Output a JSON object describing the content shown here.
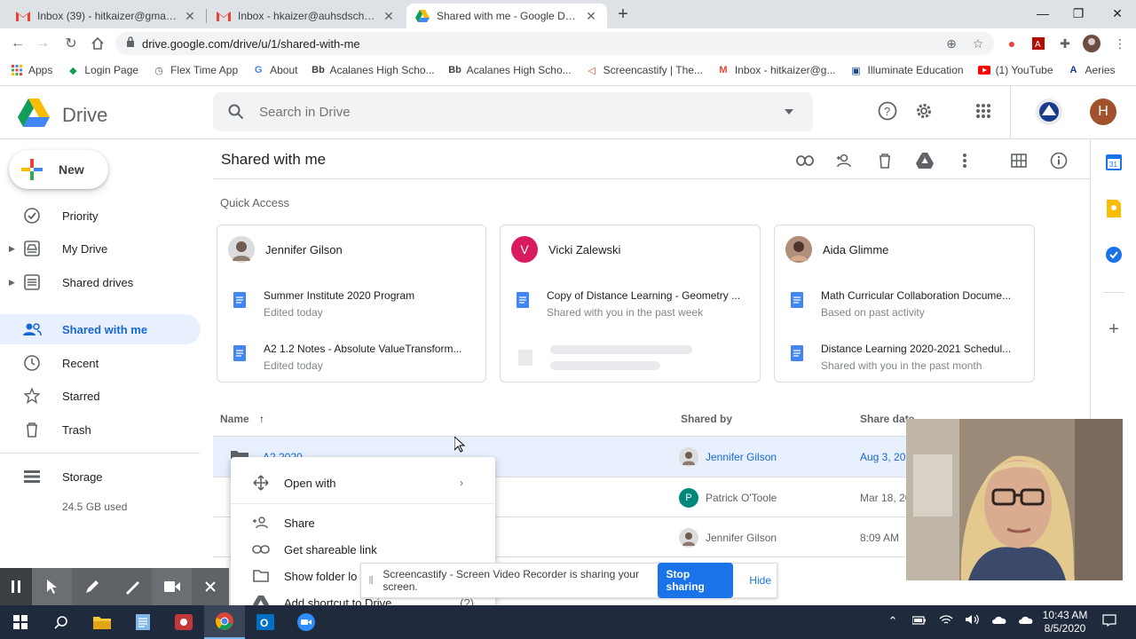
{
  "browser": {
    "tabs": [
      {
        "title": "Inbox (39) - hitkaizer@gmail.com",
        "icon": "gmail-icon",
        "active": false
      },
      {
        "title": "Inbox - hkaizer@auhsdschools.org",
        "icon": "gmail-icon",
        "active": false
      },
      {
        "title": "Shared with me - Google Drive",
        "icon": "drive-icon",
        "active": true
      }
    ],
    "new_tab": "+",
    "url": "drive.google.com/drive/u/1/shared-with-me",
    "bookmarks": [
      {
        "label": "Apps",
        "icon": "apps-grid-icon"
      },
      {
        "label": "Login Page",
        "icon": "login-icon"
      },
      {
        "label": "Flex Time App",
        "icon": "flex-time-icon"
      },
      {
        "label": "About",
        "icon": "google-icon"
      },
      {
        "label": "Acalanes High Scho...",
        "icon": "blackboard-icon"
      },
      {
        "label": "Acalanes High Scho...",
        "icon": "blackboard-icon"
      },
      {
        "label": "Screencastify | The...",
        "icon": "screencastify-icon"
      },
      {
        "label": "Inbox - hitkaizer@g...",
        "icon": "gmail-icon"
      },
      {
        "label": "Illuminate Education",
        "icon": "illuminate-icon"
      },
      {
        "label": "(1) YouTube",
        "icon": "youtube-icon"
      },
      {
        "label": "Aeries",
        "icon": "aeries-icon"
      }
    ]
  },
  "drive": {
    "app_name": "Drive",
    "search_placeholder": "Search in Drive",
    "account_initial": "H",
    "new_label": "New",
    "nav": [
      {
        "label": "Priority",
        "icon": "priority-icon",
        "expandable": false,
        "active": false
      },
      {
        "label": "My Drive",
        "icon": "my-drive-icon",
        "expandable": true,
        "active": false
      },
      {
        "label": "Shared drives",
        "icon": "shared-drives-icon",
        "expandable": true,
        "active": false
      },
      {
        "label": "Shared with me",
        "icon": "shared-with-me-icon",
        "expandable": false,
        "active": true
      },
      {
        "label": "Recent",
        "icon": "clock-icon",
        "expandable": false,
        "active": false
      },
      {
        "label": "Starred",
        "icon": "star-icon",
        "expandable": false,
        "active": false
      },
      {
        "label": "Trash",
        "icon": "trash-icon",
        "expandable": false,
        "active": false
      }
    ],
    "storage": {
      "label": "Storage",
      "used": "24.5 GB used"
    },
    "page_title": "Shared with me",
    "quick_access_label": "Quick Access",
    "quick_access": [
      {
        "owner": "Jennifer Gilson",
        "docs": [
          {
            "title": "Summer Institute 2020 Program",
            "sub": "Edited today"
          },
          {
            "title": "A2 1.2 Notes - Absolute ValueTransform...",
            "sub": "Edited today"
          }
        ]
      },
      {
        "owner": "Vicki Zalewski",
        "owner_initial": "V",
        "docs": [
          {
            "title": "Copy of Distance Learning - Geometry ...",
            "sub": "Shared with you in the past week"
          }
        ]
      },
      {
        "owner": "Aida Glimme",
        "docs": [
          {
            "title": "Math Curricular Collaboration Docume...",
            "sub": "Based on past activity"
          },
          {
            "title": "Distance Learning 2020-2021 Schedul...",
            "sub": "Shared with you in the past month"
          }
        ]
      }
    ],
    "columns": {
      "name": "Name",
      "sort_arrow": "↑",
      "shared_by": "Shared by",
      "share_date": "Share date"
    },
    "rows": [
      {
        "name": "A2 2020",
        "shared_by": "Jennifer Gilson",
        "date": "Aug 3, 2020",
        "selected": true
      },
      {
        "name": "",
        "shared_by": "Patrick O'Toole",
        "shared_initial": "P",
        "date": "Mar 18, 2020",
        "selected": false
      },
      {
        "name": "",
        "shared_by": "Jennifer Gilson",
        "date": "8:09 AM",
        "selected": false
      }
    ]
  },
  "context_menu": {
    "items": [
      {
        "label": "Open with",
        "icon": "open-with-icon",
        "submenu": true
      },
      {
        "label": "Share",
        "icon": "share-icon"
      },
      {
        "label": "Get shareable link",
        "icon": "link-icon"
      },
      {
        "label": "Show folder lo",
        "icon": "folder-icon"
      },
      {
        "label": "Add shortcut to Drive",
        "icon": "shortcut-icon",
        "badge": "(?)"
      }
    ]
  },
  "screencastify": {
    "message": "Screencastify - Screen Video Recorder is sharing your screen.",
    "stop_label": "Stop sharing",
    "hide_label": "Hide"
  },
  "taskbar": {
    "time": "10:43 AM",
    "date": "8/5/2020"
  },
  "colors": {
    "accent": "#1a73e8",
    "active_nav_bg": "#e8f0fe",
    "active_nav_text": "#1967d2",
    "taskbar": "#1f2b3c"
  }
}
